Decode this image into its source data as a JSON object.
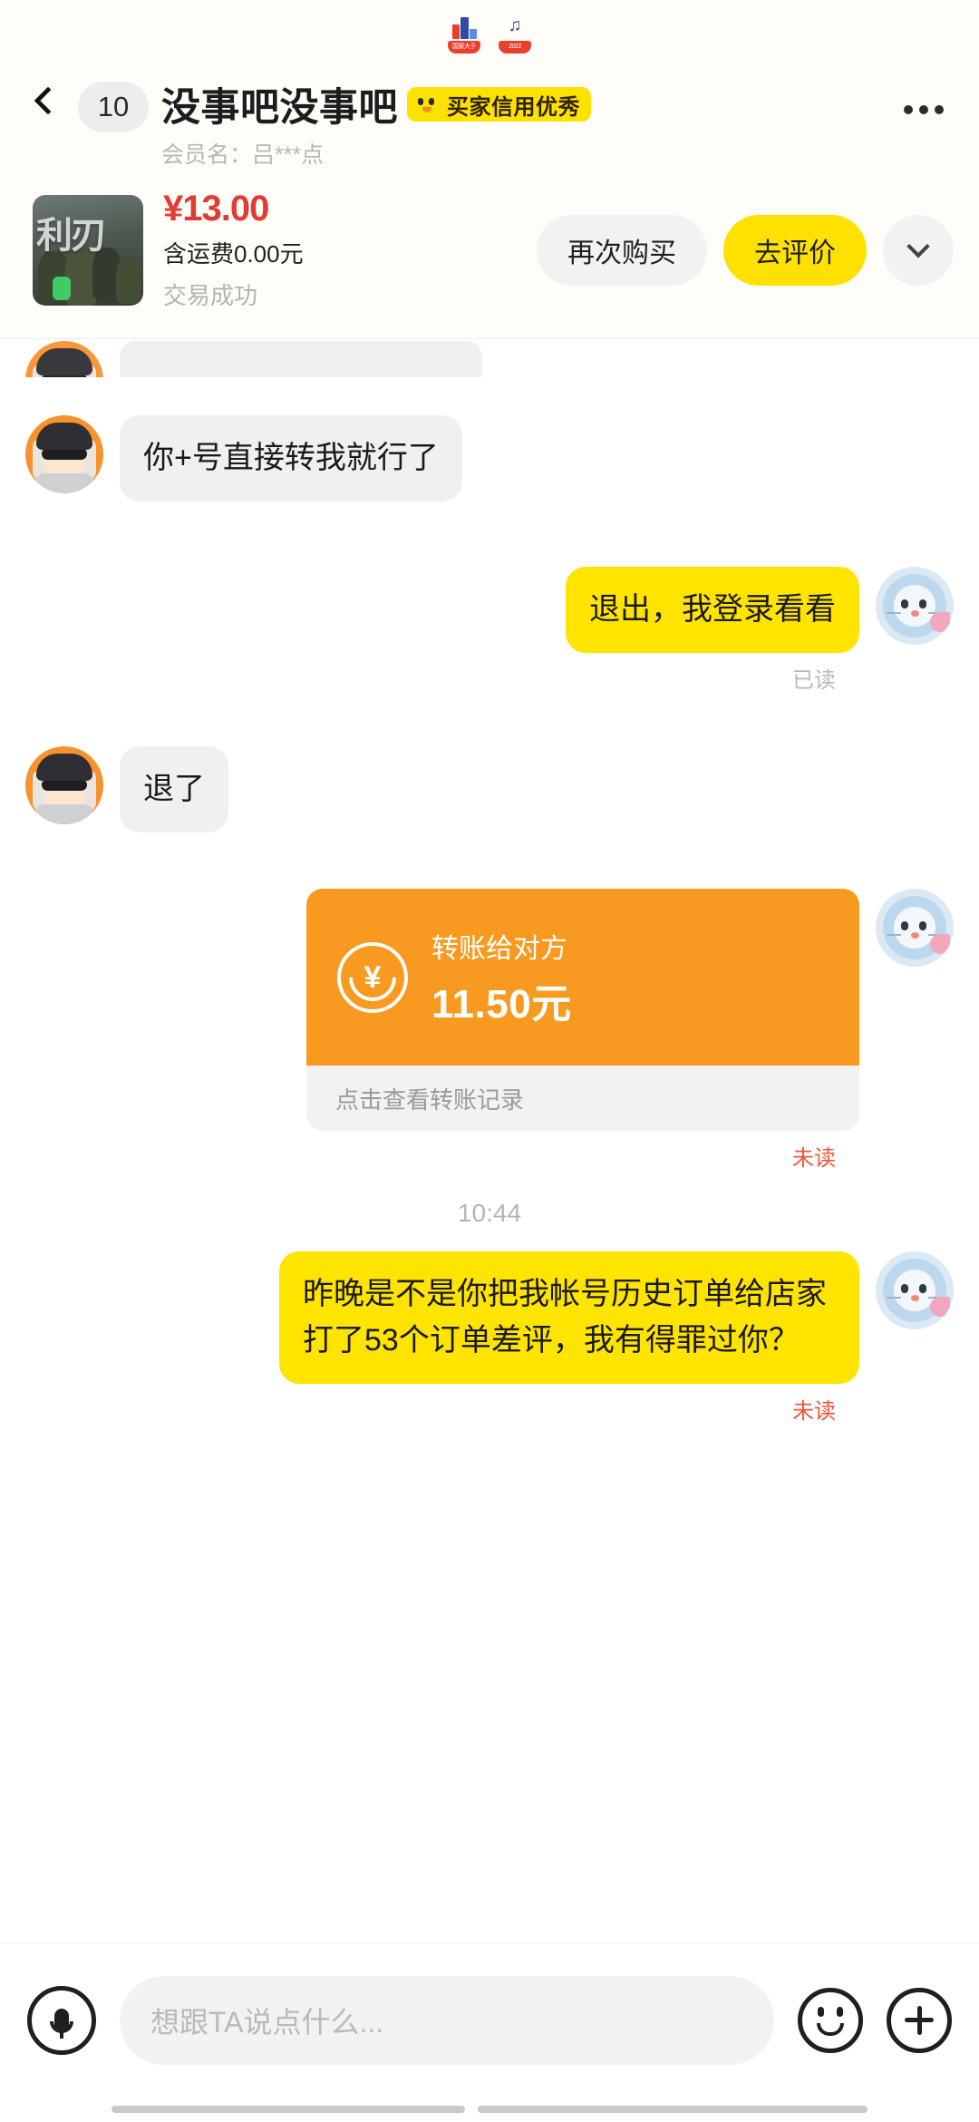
{
  "statusbar": {
    "icons": [
      "chart-app-icon",
      "music-app-icon"
    ],
    "icon1_label": "国家大于",
    "icon2_label": "2022"
  },
  "header": {
    "back_icon": "back-chevron-icon",
    "unread_count": "10",
    "title": "没事吧没事吧",
    "credit_badge": "买家信用优秀",
    "member_label": "会员名：吕***点",
    "more_icon": "more-dots-icon"
  },
  "order_card": {
    "price": "¥13.00",
    "shipping": "含运费0.00元",
    "status": "交易成功",
    "buy_again": "再次购买",
    "go_review": "去评价",
    "expand_icon": "chevron-down-icon",
    "thumb_overlay": "利刃"
  },
  "chat": {
    "messages": [
      {
        "id": "m1",
        "side": "left",
        "type": "text",
        "avatar": "girl-avatar",
        "text": "你+号直接转我就行了",
        "status": ""
      },
      {
        "id": "m2",
        "side": "right",
        "type": "text",
        "avatar": "seal-avatar",
        "text": "退出，我登录看看",
        "status": "已读",
        "status_kind": "read"
      },
      {
        "id": "m3",
        "side": "left",
        "type": "text",
        "avatar": "girl-avatar",
        "text": "退了",
        "status": ""
      },
      {
        "id": "m4",
        "side": "right",
        "type": "transfer",
        "avatar": "seal-avatar",
        "transfer_label": "转账给对方",
        "transfer_amount": "11.50元",
        "transfer_footer": "点击查看转账记录",
        "status": "未读",
        "status_kind": "unread"
      },
      {
        "id": "time1",
        "type": "time",
        "text": "10:44"
      },
      {
        "id": "m5",
        "side": "right",
        "type": "text",
        "avatar": "seal-avatar",
        "text": "昨晚是不是你把我帐号历史订单给店家打了53个订单差评，我有得罪过你？",
        "status": "未读",
        "status_kind": "unread"
      }
    ]
  },
  "input_bar": {
    "mic_icon": "microphone-icon",
    "placeholder": "想跟TA说点什么...",
    "value": "",
    "emoji_icon": "emoji-face-icon",
    "plus_icon": "plus-circle-icon"
  },
  "colors": {
    "brand_yellow": "#FFE100",
    "bubble_yellow": "#FFE400",
    "bubble_grey": "#F0F0F0",
    "price_red": "#E23B33",
    "transfer_orange": "#F79A1F",
    "unread_red": "#F0553A",
    "header_bg": "#FFFDF7"
  }
}
